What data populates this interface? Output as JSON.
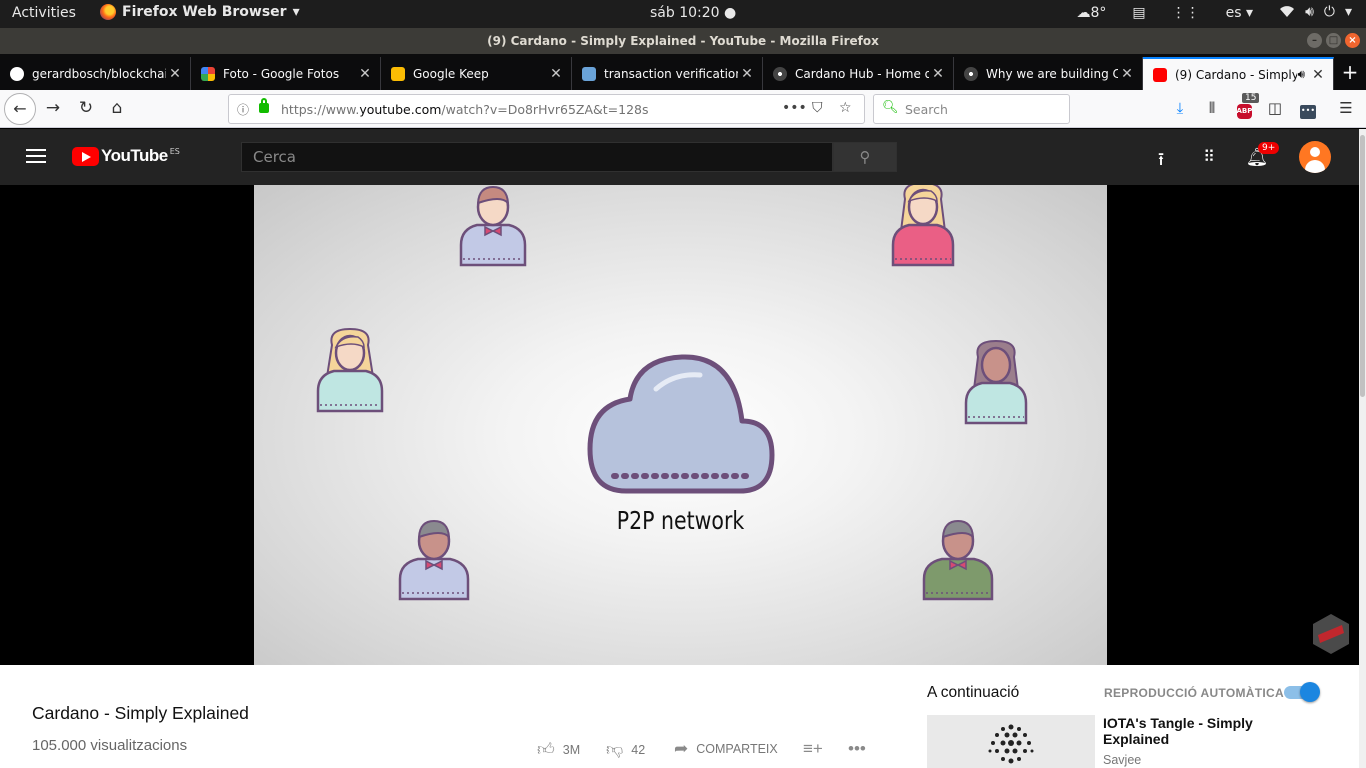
{
  "system": {
    "activities": "Activities",
    "app_name": "Firefox Web Browser",
    "app_menu_arrow": "▾",
    "clock": "sáb 10:20",
    "weather": "8°",
    "lang": "es",
    "lang_arrow": "▾"
  },
  "window": {
    "title": "(9) Cardano - Simply Explained - YouTube - Mozilla Firefox"
  },
  "tabs": [
    {
      "label": "gerardbosch/blockchain",
      "icon": "github-icon"
    },
    {
      "label": "Foto - Google Fotos",
      "icon": "google-photos-icon"
    },
    {
      "label": "Google Keep",
      "icon": "google-keep-icon"
    },
    {
      "label": "transaction verification",
      "icon": "blockchain-icon"
    },
    {
      "label": "Cardano Hub - Home of",
      "icon": "cardano-icon"
    },
    {
      "label": "Why we are building Ca",
      "icon": "cardano-icon"
    },
    {
      "label": "(9) Cardano - Simply",
      "icon": "youtube-icon",
      "active": true
    }
  ],
  "navbar": {
    "url_prefix": "https://www.",
    "url_domain": "youtube.com",
    "url_path": "/watch?v=Do8rHvr65ZA&t=128s",
    "search_placeholder": "Search",
    "abp_count": "15"
  },
  "youtube": {
    "logo_text": "YouTube",
    "region": "ES",
    "search_placeholder": "Cerca",
    "notifications": "9+"
  },
  "video": {
    "frame_caption": "P2P network",
    "title": "Cardano - Simply Explained",
    "views": "105.000 visualitzacions",
    "likes": "3M",
    "dislikes": "42",
    "share": "COMPARTEIX"
  },
  "sidebar": {
    "next_label": "A continuació",
    "autoplay_label": "REPRODUCCIÓ AUTOMÀTICA",
    "autoplay_on": true,
    "next_video_title": "IOTA's Tangle - Simply Explained",
    "next_video_channel": "Savjee"
  },
  "colors": {
    "youtube_red": "#ff0000",
    "yt_header": "#232323",
    "firefox_accent": "#0a84ff",
    "cloud_fill": "#b6c2dc",
    "cloud_stroke": "#6d4f7a"
  }
}
